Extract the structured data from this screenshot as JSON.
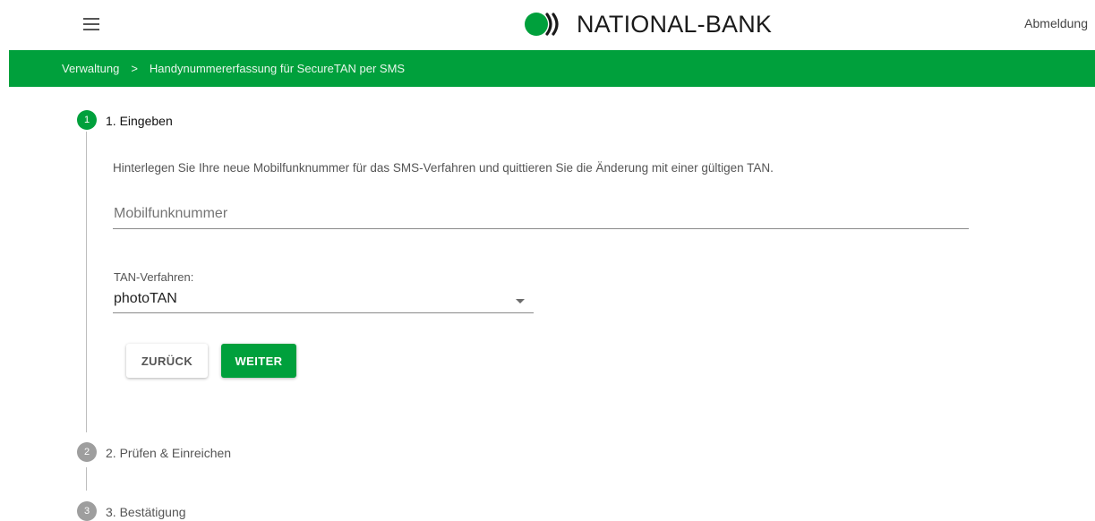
{
  "header": {
    "brand": "NATIONAL-BANK",
    "logout_label": "Abmeldung",
    "menu_icon": "hamburger-menu-icon",
    "logo_icon": "national-bank-logo-icon"
  },
  "breadcrumb": {
    "items": [
      "Verwaltung",
      "Handynummererfassung für SecureTAN per SMS"
    ],
    "separator": ">"
  },
  "colors": {
    "brand_green": "#00a03c",
    "inactive_step": "#9e9e9e"
  },
  "steps": [
    {
      "number": "1",
      "title": "1. Eingeben",
      "state": "active"
    },
    {
      "number": "2",
      "title": "2. Prüfen & Einreichen",
      "state": "inactive"
    },
    {
      "number": "3",
      "title": "3. Bestätigung",
      "state": "inactive"
    }
  ],
  "form": {
    "description": "Hinterlegen Sie Ihre neue Mobilfunknummer für das SMS-Verfahren und quittieren Sie die Änderung mit einer gültigen TAN.",
    "mobile_placeholder": "Mobilfunknummer",
    "mobile_value": "",
    "tan_label": "TAN-Verfahren:",
    "tan_selected": "photoTAN",
    "back_label": "ZURÜCK",
    "next_label": "WEITER"
  }
}
